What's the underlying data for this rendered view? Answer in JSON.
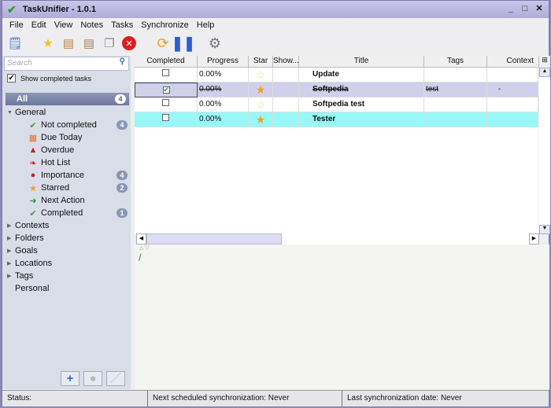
{
  "app": {
    "title": "TaskUnifier - 1.0.1"
  },
  "menu": [
    "File",
    "Edit",
    "View",
    "Notes",
    "Tasks",
    "Synchronize",
    "Help"
  ],
  "toolbar": [
    "new-task-icon",
    "add-folder-icon",
    "edit-icon",
    "template-icon",
    "copy-icon",
    "delete-icon",
    "sync-icon",
    "pause-icon",
    "settings-icon"
  ],
  "sidebar": {
    "search_placeholder": "Search",
    "show_completed_label": "Show completed tasks",
    "show_completed": true,
    "all": {
      "label": "All",
      "count": "4"
    },
    "general": {
      "label": "General",
      "items": [
        {
          "label": "Not completed",
          "count": "4",
          "icon": "check-icon"
        },
        {
          "label": "Due Today",
          "count": null,
          "icon": "calendar-icon"
        },
        {
          "label": "Overdue",
          "count": null,
          "icon": "warning-icon"
        },
        {
          "label": "Hot List",
          "count": null,
          "icon": "chili-icon"
        },
        {
          "label": "Importance",
          "count": "4",
          "icon": "exclamation-icon"
        },
        {
          "label": "Starred",
          "count": "2",
          "icon": "star-icon"
        },
        {
          "label": "Next Action",
          "count": null,
          "icon": "arrow-icon"
        },
        {
          "label": "Completed",
          "count": "1",
          "icon": "check-icon"
        }
      ]
    },
    "groups": [
      "Contexts",
      "Folders",
      "Goals",
      "Locations",
      "Tags"
    ],
    "personal": "Personal"
  },
  "table": {
    "columns": [
      "Completed",
      "Progress",
      "Star",
      "Show...",
      "Title",
      "Tags",
      "Context"
    ],
    "rows": [
      {
        "completed": false,
        "progress": "0.00%",
        "starred": false,
        "title": "Update",
        "tags": "",
        "context": ""
      },
      {
        "completed": true,
        "progress": "0.00%",
        "starred": true,
        "title": "Softpedia",
        "tags": "test",
        "context": "-"
      },
      {
        "completed": false,
        "progress": "0.00%",
        "starred": false,
        "title": "Softpedia test",
        "tags": "",
        "context": ""
      },
      {
        "completed": false,
        "progress": "0.00%",
        "starred": true,
        "title": "Tester",
        "tags": "",
        "context": ""
      }
    ]
  },
  "status": {
    "status": "Status:",
    "next_sync": "Next scheduled synchronization: Never",
    "last_sync": "Last synchronization date: Never"
  },
  "colors": {
    "selected_row": "#d0d0ea",
    "highlight_row": "#98f8f8",
    "title_bar": "#b7b4dc"
  }
}
